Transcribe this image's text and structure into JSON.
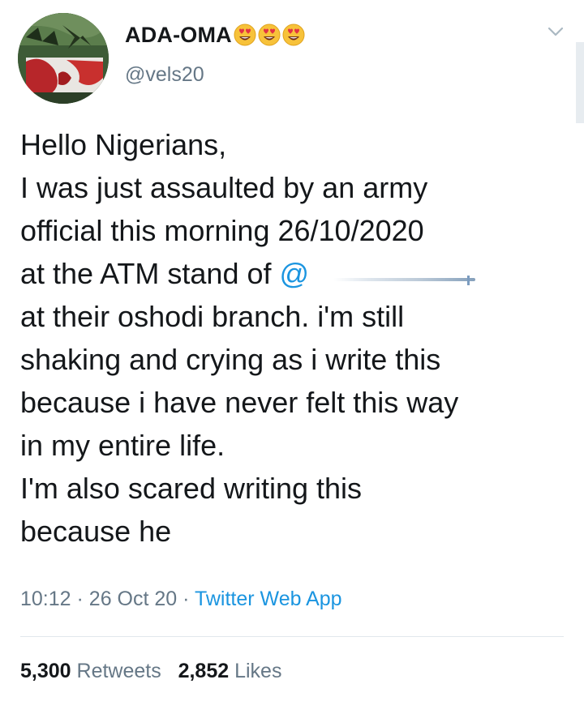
{
  "user": {
    "display_name": "ADA-OMA",
    "handle": "@vels20",
    "name_emoji": [
      "heart-eyes-emoji",
      "heart-eyes-emoji",
      "heart-eyes-emoji"
    ]
  },
  "tweet": {
    "lines": [
      "Hello Nigerians,",
      "I was just assaulted by an army",
      "official this morning 26/10/2020",
      "at the ATM stand of ",
      "at their oshodi branch. i'm still",
      "shaking and crying as i write this",
      "because i have never felt this way",
      "in my entire life.",
      "I'm also scared writing this",
      "because he"
    ],
    "mention_prefix": "@",
    "time": "10:12",
    "date": "26 Oct 20",
    "separator": "·",
    "source": "Twitter Web App"
  },
  "stats": {
    "retweets_count": "5,300",
    "retweets_label": "Retweets",
    "likes_count": "2,852",
    "likes_label": "Likes"
  },
  "colors": {
    "text": "#14171a",
    "secondary": "#657786",
    "link": "#1b95e0",
    "divider": "#e1e8ed"
  },
  "icons": {
    "menu": "chevron-down-icon"
  }
}
